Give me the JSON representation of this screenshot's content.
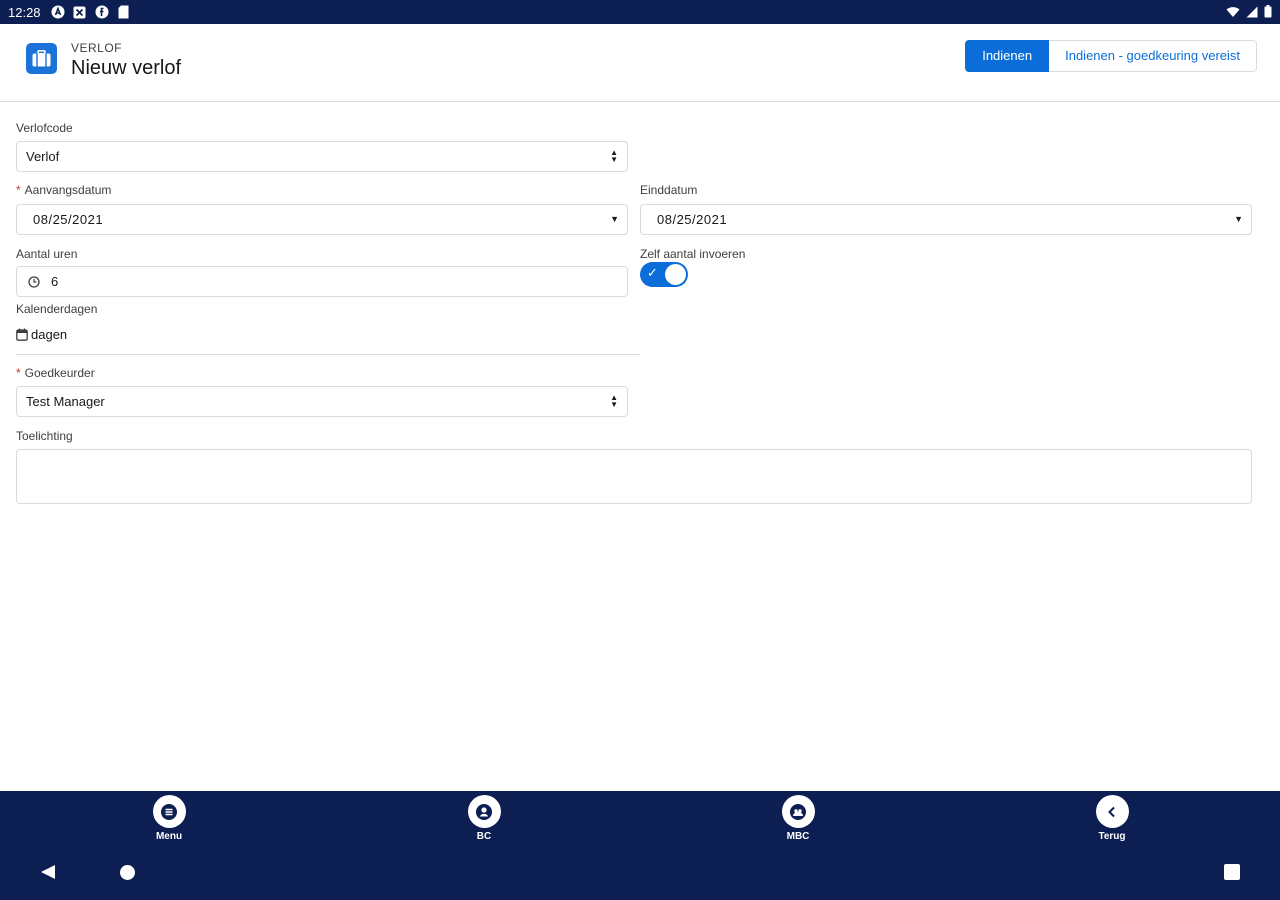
{
  "status_bar": {
    "time": "12:28"
  },
  "header": {
    "subtitle": "VERLOF",
    "title": "Nieuw verlof",
    "icon": "briefcase-icon",
    "submit_label": "Indienen",
    "submit_approval_label": "Indienen - goedkeuring vereist"
  },
  "form": {
    "leave_code": {
      "label": "Verlofcode",
      "value": "Verlof"
    },
    "start_date": {
      "label": "Aanvangsdatum",
      "required": "*",
      "value": "08/25/2021"
    },
    "end_date": {
      "label": "Einddatum",
      "value": "08/25/2021"
    },
    "hours": {
      "label": "Aantal uren",
      "value": "6"
    },
    "manual_entry": {
      "label": "Zelf aantal invoeren",
      "enabled": true
    },
    "calendar_days": {
      "label": "Kalenderdagen",
      "value": "dagen"
    },
    "approver": {
      "label": "Goedkeurder",
      "required": "*",
      "value": "Test Manager"
    },
    "notes": {
      "label": "Toelichting",
      "value": ""
    }
  },
  "bottom_nav": {
    "items": [
      {
        "label": "Menu",
        "icon": "menu-icon"
      },
      {
        "label": "BC",
        "icon": "person-icon"
      },
      {
        "label": "MBC",
        "icon": "group-icon"
      },
      {
        "label": "Terug",
        "icon": "chevron-left-icon"
      }
    ]
  },
  "colors": {
    "brand_navy": "#0d1e52",
    "accent_blue": "#0b6ed8",
    "required_red": "#c23934"
  }
}
